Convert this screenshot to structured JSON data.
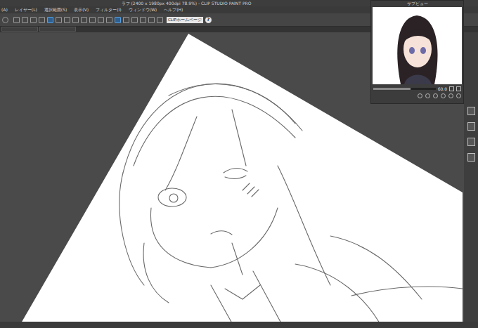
{
  "window": {
    "title": "ラフ (2400 x 1980px 400dpi 78.9%) - CLIP STUDIO PAINT PRO"
  },
  "menu": [
    "(A)",
    "レイヤー(L)",
    "選択範囲(S)",
    "表示(V)",
    "フィルター(I)",
    "ウィンドウ(W)",
    "ヘルプ(H)"
  ],
  "toolbar": {
    "homepage_button": "CLIPホームページ",
    "help_button": "?"
  },
  "subview": {
    "title": "サブビュー",
    "zoom": "60.0",
    "zoom_level": 0.6
  }
}
